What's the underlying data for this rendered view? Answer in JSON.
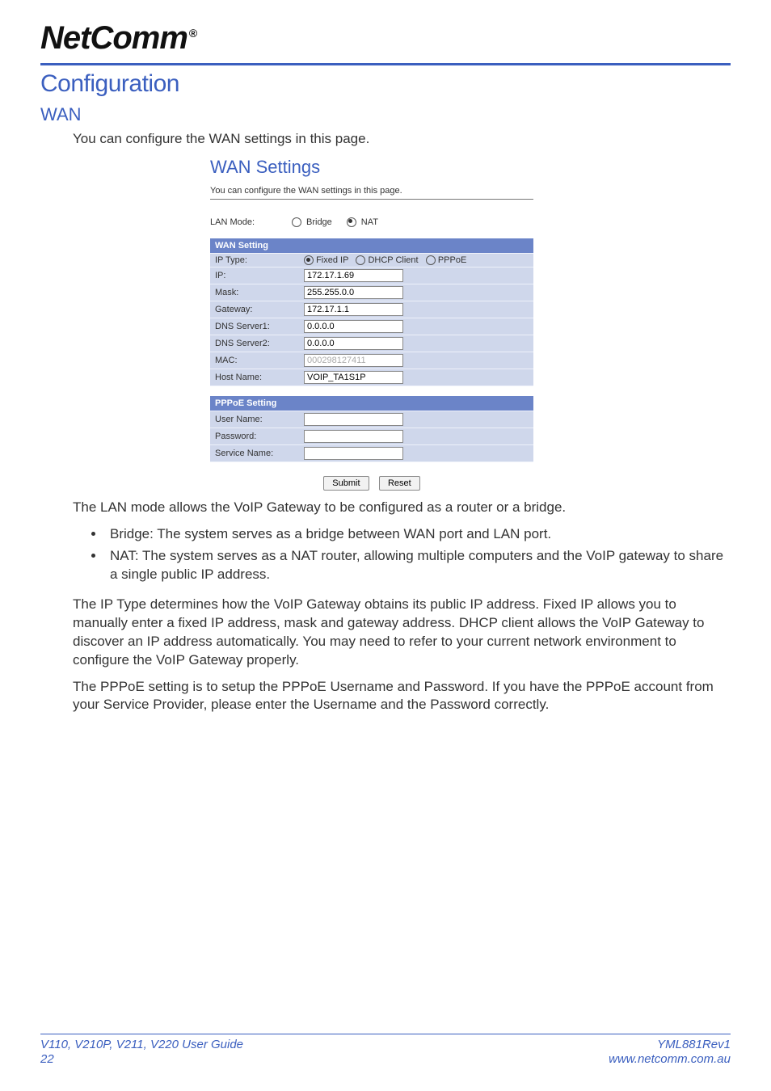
{
  "brand": {
    "name": "NetComm",
    "reg": "®"
  },
  "h1": "Configuration",
  "h2": "WAN",
  "intro": "You can configure the WAN settings in this page.",
  "shot": {
    "title": "WAN Settings",
    "sub": "You can configure the WAN settings in this page.",
    "lan_mode_label": "LAN Mode:",
    "lan_mode_options": {
      "bridge": "Bridge",
      "nat": "NAT"
    },
    "lan_mode_selected": "NAT",
    "wan_header": "WAN Setting",
    "fields": {
      "ip_type_label": "IP Type:",
      "ip_type_options": {
        "fixed": "Fixed IP",
        "dhcp": "DHCP Client",
        "pppoe": "PPPoE"
      },
      "ip_type_selected": "Fixed IP",
      "ip_label": "IP:",
      "ip_value": "172.17.1.69",
      "mask_label": "Mask:",
      "mask_value": "255.255.0.0",
      "gateway_label": "Gateway:",
      "gateway_value": "172.17.1.1",
      "dns1_label": "DNS Server1:",
      "dns1_value": "0.0.0.0",
      "dns2_label": "DNS Server2:",
      "dns2_value": "0.0.0.0",
      "mac_label": "MAC:",
      "mac_value": "000298127411",
      "host_label": "Host Name:",
      "host_value": "VOIP_TA1S1P"
    },
    "pppoe_header": "PPPoE Setting",
    "pppoe": {
      "user_label": "User Name:",
      "user_value": "",
      "pass_label": "Password:",
      "pass_value": "",
      "service_label": "Service Name:",
      "service_value": ""
    },
    "buttons": {
      "submit": "Submit",
      "reset": "Reset"
    }
  },
  "para_lanmode": "The LAN mode allows the VoIP Gateway to be configured as a router or a bridge.",
  "bullets": {
    "bridge": "Bridge: The system serves as a bridge between WAN port and LAN port.",
    "nat": "NAT: The system serves as a NAT router, allowing multiple computers and the VoIP gateway to share a single public IP address."
  },
  "para_iptype": "The IP Type determines how the VoIP Gateway obtains its public IP address. Fixed IP allows you to manually enter a fixed IP address, mask and gateway address. DHCP client allows the VoIP Gateway to discover an IP address automatically. You may need to refer to your current network environment to configure the VoIP Gateway properly.",
  "para_pppoe": "The PPPoE setting is to setup the PPPoE Username and Password. If you have the PPPoE account from your Service Provider, please enter the Username and the Password correctly.",
  "footer": {
    "left_top": "V110, V210P, V211, V220 User Guide",
    "left_bottom": "22",
    "right_top": "YML881Rev1",
    "right_bottom": "www.netcomm.com.au"
  }
}
